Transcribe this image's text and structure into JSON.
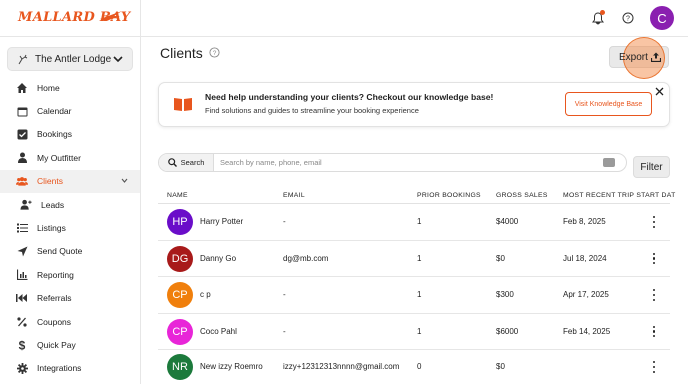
{
  "brand": {
    "logo_text": "MALLARD BAY",
    "accent": "#e8561e"
  },
  "topbar": {
    "user_initial": "C",
    "icons": [
      "bell-icon",
      "help-icon"
    ]
  },
  "lodge_selector": {
    "label": "The Antler Lodge"
  },
  "sidebar": {
    "items": [
      {
        "label": "Home",
        "icon": "home-icon",
        "active": false
      },
      {
        "label": "Calendar",
        "icon": "calendar-icon",
        "active": false
      },
      {
        "label": "Bookings",
        "icon": "bookings-icon",
        "active": false
      },
      {
        "label": "My Outfitter",
        "icon": "person-icon",
        "active": false
      },
      {
        "label": "Clients",
        "icon": "clients-icon",
        "active": true
      },
      {
        "label": "Leads",
        "icon": "leads-icon",
        "active": false
      },
      {
        "label": "Listings",
        "icon": "list-icon",
        "active": false
      },
      {
        "label": "Send Quote",
        "icon": "send-icon",
        "active": false
      },
      {
        "label": "Reporting",
        "icon": "reporting-icon",
        "active": false
      },
      {
        "label": "Referrals",
        "icon": "referrals-icon",
        "active": false
      },
      {
        "label": "Coupons",
        "icon": "percent-icon",
        "active": false
      },
      {
        "label": "Quick Pay",
        "icon": "dollar-icon",
        "active": false
      },
      {
        "label": "Integrations",
        "icon": "gear-icon",
        "active": false
      }
    ]
  },
  "page": {
    "title": "Clients",
    "export_label": "Export"
  },
  "banner": {
    "title": "Need help understanding your clients? Checkout our knowledge base!",
    "text": "Find solutions and guides to streamline your booking experience",
    "button_label": "Visit Knowledge Base"
  },
  "search": {
    "button_label": "Search",
    "placeholder": "Search by name, phone, email",
    "filter_label": "Filter"
  },
  "table": {
    "columns": [
      "NAME",
      "EMAIL",
      "PRIOR BOOKINGS",
      "GROSS SALES",
      "MOST RECENT TRIP START DAT"
    ],
    "rows": [
      {
        "initials": "HP",
        "color": "#6a0dc9",
        "name": "Harry Potter",
        "email": "-",
        "prior": "1",
        "sales": "$4000",
        "date": "Feb 8, 2025"
      },
      {
        "initials": "DG",
        "color": "#a81a1a",
        "name": "Danny Go",
        "email": "dg@mb.com",
        "prior": "1",
        "sales": "$0",
        "date": "Jul 18, 2024"
      },
      {
        "initials": "CP",
        "color": "#f07f0c",
        "name": "c p",
        "email": "-",
        "prior": "1",
        "sales": "$300",
        "date": "Apr 17, 2025"
      },
      {
        "initials": "CP",
        "color": "#e825d8",
        "name": "Coco Pahl",
        "email": "-",
        "prior": "1",
        "sales": "$6000",
        "date": "Feb 14, 2025"
      },
      {
        "initials": "NR",
        "color": "#1c7a3c",
        "name": "New izzy Roemro",
        "email": "izzy+12312313nnnn@gmail.com",
        "prior": "0",
        "sales": "$0",
        "date": ""
      }
    ]
  }
}
